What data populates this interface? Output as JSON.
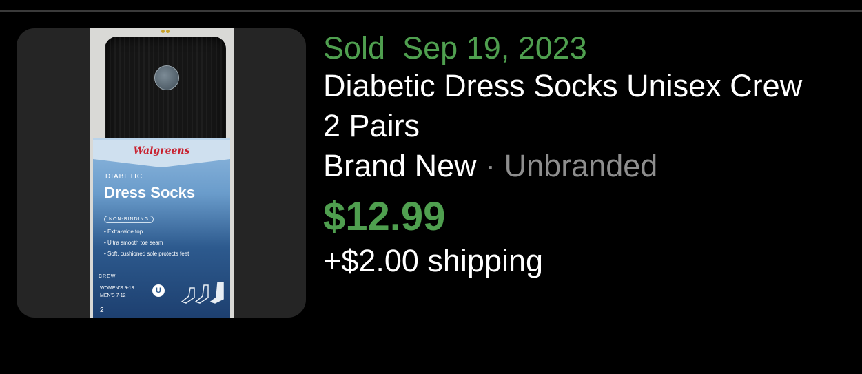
{
  "listing": {
    "sold_label": "Sold",
    "sold_date": "Sep 19, 2023",
    "title": "Diabetic Dress Socks Unisex Crew 2 Pairs",
    "condition": "Brand New",
    "separator": "·",
    "brand": "Unbranded",
    "price": "$12.99",
    "shipping": "+$2.00 shipping"
  },
  "photo": {
    "package_brand": "Walgreens",
    "package_line1": "DIABETIC",
    "package_line2": "Dress Socks",
    "package_badge": "NON-BINDING",
    "package_bullets": [
      "• Extra-wide top",
      "• Ultra smooth toe seam",
      "• Soft, cushioned sole protects feet"
    ],
    "package_crew": "CREW",
    "package_sizes": [
      "WOMEN'S 9-13",
      "MEN'S 7-12"
    ],
    "package_u": "U",
    "package_count": "2"
  },
  "colors": {
    "sold_green": "#4f9f4f",
    "price_green": "#4f9f4f",
    "secondary_gray": "#8e8e8e",
    "background": "#000000",
    "thumb_bg": "#252525"
  }
}
